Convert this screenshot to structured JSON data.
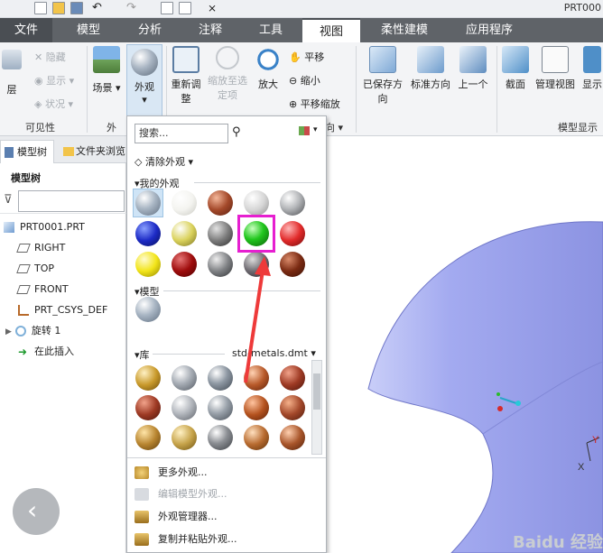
{
  "window": {
    "title": "PRT000"
  },
  "tabs": [
    "文件",
    "模型",
    "分析",
    "注释",
    "工具",
    "视图",
    "柔性建模",
    "应用程序"
  ],
  "ribbon": {
    "layer": "层",
    "hide": "隐藏",
    "show": "显示",
    "status": "状况",
    "scene": "场景",
    "appearance": "外观",
    "regenerate": "重新调整",
    "zoom_selected": "缩放至选定项",
    "zoom_in": "放大",
    "pan": "平移",
    "zoom_out": "缩小",
    "pan_zoom": "平移缩放",
    "saved_orientation": "已保存方向",
    "standard_orientation": "标准方向",
    "previous": "上一个",
    "section": "截面",
    "manage_views": "管理视图",
    "display": "显示",
    "group_visibility": "可见性",
    "group_appearance": "外",
    "group_orientation": "向",
    "group_model_display": "模型显示"
  },
  "left_panel": {
    "tab_model_tree": "模型树",
    "tab_folder_browser": "文件夹浏览",
    "title": "模型树",
    "nodes": [
      "PRT0001.PRT",
      "RIGHT",
      "TOP",
      "FRONT",
      "PRT_CSYS_DEF",
      "旋转 1",
      "在此插入"
    ]
  },
  "dropdown": {
    "search_placeholder": "搜索...",
    "clear_appearance": "清除外观",
    "my_appearances": "我的外观",
    "model": "模型",
    "library": "库",
    "library_name": "std-metals.dmt",
    "more_appearances": "更多外观...",
    "edit_model_appearance": "编辑模型外观...",
    "appearance_manager": "外观管理器...",
    "copy_paste_appearance": "复制并粘贴外观..."
  },
  "colors": {
    "tab_bar": "#5f6368",
    "highlight_box": "#e61fd0",
    "arrow": "#ee3a3a",
    "model_surface": "#a7aef0",
    "selected_sphere": "#22c71e"
  },
  "icons": [
    "layer-icon",
    "hide-icon",
    "show-icon",
    "status-icon",
    "scene-icon",
    "appearance-icon",
    "regenerate-icon",
    "zoom-selected-icon",
    "zoom-in-icon",
    "pan-icon",
    "zoom-out-icon",
    "pan-zoom-icon",
    "saved-orientation-icon",
    "standard-orientation-icon",
    "previous-orientation-icon",
    "section-icon",
    "manage-views-icon",
    "search-icon",
    "eraser-icon",
    "part-icon",
    "plane-icon",
    "csys-icon",
    "revolve-icon",
    "insert-here-icon",
    "back-arrow-icon",
    "palette-icon"
  ],
  "watermark": "Baidu 经验"
}
